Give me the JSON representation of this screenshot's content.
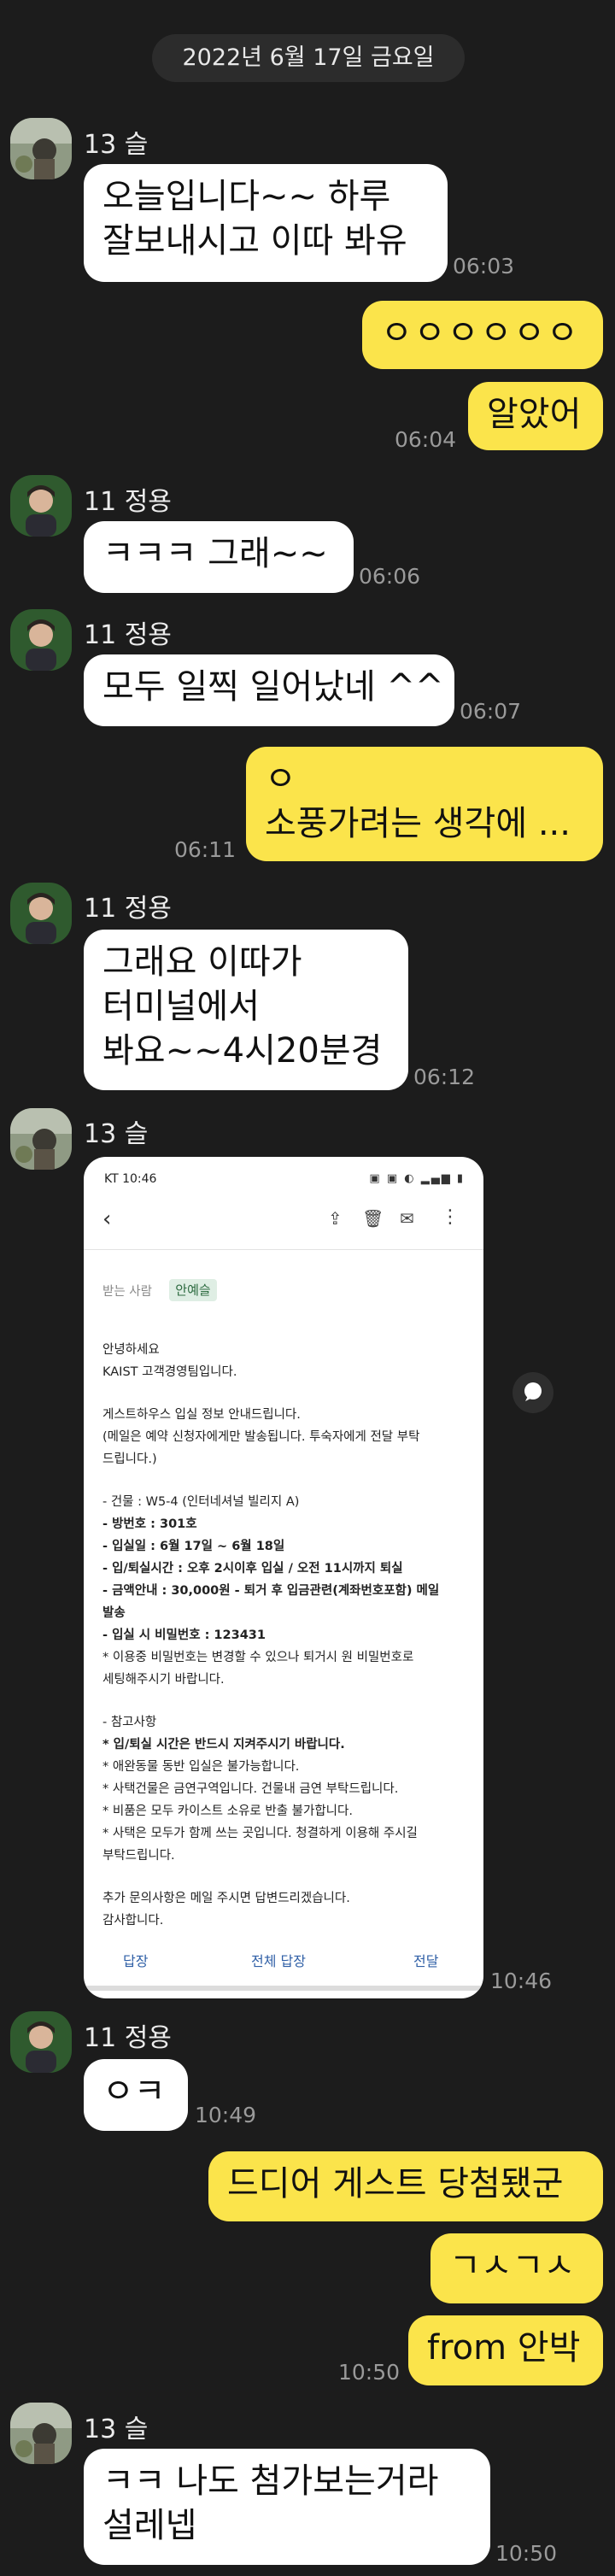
{
  "date_divider": "2022년 6월 17일 금요일",
  "messages": [
    {
      "sender": "13 슬",
      "lines": [
        "오늘입니다~~  하루",
        "잘보내시고 이따 봐유"
      ],
      "time": "06:03"
    },
    {
      "text": "ㅇㅇㅇㅇㅇㅇ"
    },
    {
      "text": "알았어",
      "time": "06:04"
    },
    {
      "sender": "11 정용",
      "text": "ㅋㅋㅋ 그래~~",
      "time": "06:06"
    },
    {
      "sender": "11 정용",
      "text": "모두 일찍 일어났네 ^^",
      "time": "06:07"
    },
    {
      "lines": [
        "ㅇ",
        "소풍가려는 생각에 ..."
      ],
      "time": "06:11"
    },
    {
      "sender": "11 정용",
      "lines": [
        "그래요 이따가",
        "터미널에서",
        "봐요~~4시20분경"
      ],
      "time": "06:12"
    },
    {
      "sender": "13 슬",
      "time": "10:46"
    },
    {
      "sender": "11 정용",
      "text": "ㅇㅋ",
      "time": "10:49"
    },
    {
      "text": "드디어 게스트 당첨됐군"
    },
    {
      "text": "ㄱㅅㄱㅅ"
    },
    {
      "text": "from 안박",
      "time": "10:50"
    },
    {
      "sender": "13 슬",
      "lines": [
        "ㅋㅋ 나도 첨가보는거라",
        "설레넵"
      ],
      "time": "10:50"
    }
  ],
  "email_screenshot": {
    "status_bar": "KT 10:46",
    "recipient_label": "받는 사람",
    "recipient_tag": "안예슬",
    "lines": [
      "안녕하세요",
      "KAIST 고객경영팀입니다.",
      "게스트하우스 입실 정보 안내드립니다.",
      "(메일은 예약 신청자에게만 발송됩니다. 투숙자에게 전달 부탁",
      "드립니다.)",
      "- 건물 : W5-4 (인터네셔널 빌리지 A)",
      "- 방번호 : 301호",
      "- 입실일 : 6월 17일 ~ 6월 18일",
      "- 입/퇴실시간 : 오후 2시이후 입실 / 오전 11시까지 퇴실",
      "- 금액안내 : 30,000원 - 퇴거 후 입금관련(계좌번호포함) 메일",
      "발송",
      "- 입실 시 비밀번호 : 123431",
      "   * 이용중 비밀번호는 변경할 수 있으나 퇴거시 원 비밀번호로",
      "세팅해주시기 바랍니다.",
      "- 참고사항",
      "   * 입/퇴실 시간은 반드시 지켜주시기 바랍니다.",
      "   * 애완동물 동반 입실은 불가능합니다.",
      "   * 사택건물은 금연구역입니다. 건물내 금연 부탁드립니다.",
      "   * 비품은 모두 카이스트 소유로 반출 불가합니다.",
      "   * 사택은 모두가 함께 쓰는 곳입니다. 청결하게 이용해 주시길",
      "부탁드립니다.",
      "추가 문의사항은 메일 주시면 답변드리겠습니다.",
      "감사합니다."
    ],
    "actions": [
      "답장",
      "전체 답장",
      "전달"
    ]
  },
  "colors": {
    "background": "#1c1c1c",
    "my_bubble": "#fbe44b",
    "their_bubble": "#ffffff"
  }
}
